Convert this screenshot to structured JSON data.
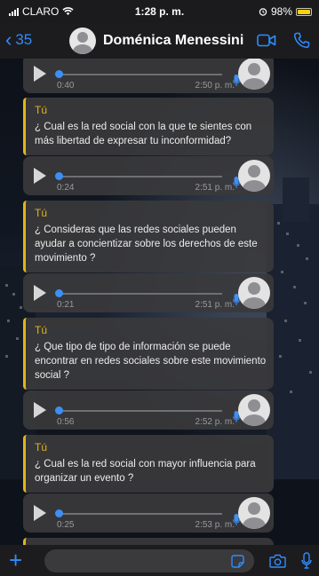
{
  "status": {
    "carrier": "CLARO",
    "time": "1:28 p. m.",
    "battery": "98%"
  },
  "header": {
    "back_count": "35",
    "contact_name": "Doménica Menessini"
  },
  "colors": {
    "accent": "#2f8cff",
    "sender": "#e2b417",
    "bubble": "#3a3a3c",
    "battery": "#f3d11b"
  },
  "messages": [
    {
      "type": "voice",
      "duration": "0:40",
      "time": "2:50 p. m."
    },
    {
      "type": "text",
      "sender": "Tú",
      "text": "¿ Cual es la red social con la que te sientes con más libertad de expresar tu inconformidad?"
    },
    {
      "type": "voice",
      "duration": "0:24",
      "time": "2:51 p. m."
    },
    {
      "type": "text",
      "sender": "Tú",
      "text": "¿ Consideras que las redes sociales pueden ayudar a concientizar sobre los derechos de este movimiento ?"
    },
    {
      "type": "voice",
      "duration": "0:21",
      "time": "2:51 p. m."
    },
    {
      "type": "text",
      "sender": "Tú",
      "text": "¿ Que tipo de tipo de información se puede encontrar en redes sociales sobre este movimiento social ?"
    },
    {
      "type": "voice",
      "duration": "0:56",
      "time": "2:52 p. m."
    },
    {
      "type": "text",
      "sender": "Tú",
      "text": "¿ Cual es la red social con mayor influencia para organizar un evento ?"
    },
    {
      "type": "voice",
      "duration": "0:25",
      "time": "2:53 p. m."
    },
    {
      "type": "text",
      "sender": "Tú",
      "text": ""
    }
  ],
  "input": {
    "placeholder": ""
  },
  "icons": {
    "back": "chevron-left-icon",
    "video": "video-camera-icon",
    "phone": "phone-icon",
    "plus": "plus-icon",
    "sticker": "sticker-icon",
    "camera": "camera-icon",
    "mic": "microphone-icon"
  }
}
